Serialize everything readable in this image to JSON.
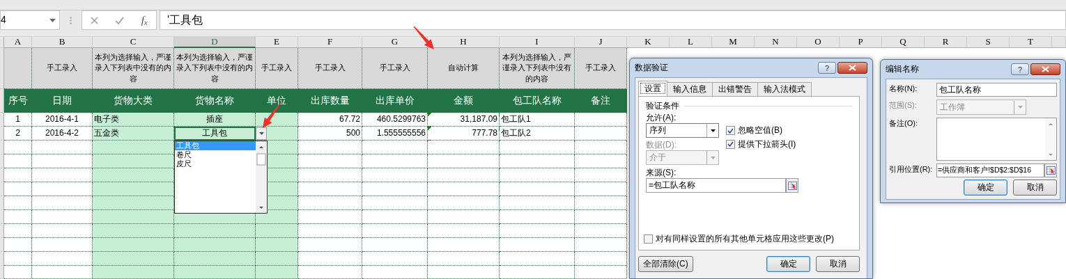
{
  "formula_bar": {
    "name_box": "4",
    "function_label": "f$_{x}$",
    "formula": "'工具包"
  },
  "sheet": {
    "columns": [
      {
        "letter": "A",
        "selected": false,
        "kind": "center",
        "highlighted": false,
        "title": "序号",
        "cells": [
          {
            "text": "1",
            "selected": false
          },
          {
            "text": "2",
            "selected": false
          }
        ]
      },
      {
        "letter": "B",
        "selected": false,
        "kind": "center",
        "highlighted": false,
        "note": "手工录入",
        "title": "日期",
        "cells": [
          {
            "text": "2016-4-1",
            "selected": false
          },
          {
            "text": "2016-4-2",
            "selected": false
          }
        ]
      },
      {
        "letter": "C",
        "selected": false,
        "kind": "text",
        "highlighted": true,
        "note": "本列为选择输入，严谨录入下列表中没有的内容",
        "title": "货物大类",
        "cells": [
          {
            "text": "电子类",
            "selected": false
          },
          {
            "text": "五金类",
            "selected": false
          }
        ]
      },
      {
        "letter": "D",
        "selected": true,
        "kind": "center",
        "highlighted": true,
        "note": "本列为选择输入，严谨录入下列表中没有的内容",
        "title": "货物名称",
        "cells": [
          {
            "text": "插座",
            "selected": false
          },
          {
            "text": "工具包",
            "selected": true
          }
        ]
      },
      {
        "letter": "E",
        "selected": false,
        "kind": "center",
        "highlighted": true,
        "note": "手工录入",
        "title": "单位"
      },
      {
        "letter": "F",
        "selected": false,
        "kind": "number",
        "highlighted": false,
        "note": "手工录入",
        "title": "出库数量",
        "cells": [
          {
            "text": "67.72",
            "selected": false
          },
          {
            "text": "500",
            "selected": false
          }
        ]
      },
      {
        "letter": "G",
        "selected": false,
        "kind": "number",
        "highlighted": false,
        "note": "手工录入",
        "title": "出库单价",
        "cells": [
          {
            "text": "460.5299763",
            "selected": false
          },
          {
            "text": "1.555555556",
            "selected": false
          }
        ]
      },
      {
        "letter": "H",
        "selected": false,
        "kind": "number",
        "highlighted": false,
        "note": "自动计算",
        "title": "金额",
        "cells": [
          {
            "text": "31,187.09",
            "selected": false,
            "flagged": true
          },
          {
            "text": "777.78",
            "selected": false,
            "flagged": true
          }
        ]
      },
      {
        "letter": "I",
        "selected": false,
        "kind": "text",
        "highlighted": false,
        "note": "本列为选择输入，严谨录入下列表中没有的内容",
        "title": "包工队名称",
        "cells": [
          {
            "text": "包工队1",
            "selected": false
          },
          {
            "text": "包工队2",
            "selected": false
          }
        ]
      },
      {
        "letter": "J",
        "selected": false,
        "kind": "center",
        "highlighted": false,
        "note": "手工录入",
        "title": "备注"
      },
      {
        "letter": "K",
        "selected": false
      },
      {
        "letter": "L",
        "selected": false
      },
      {
        "letter": "M",
        "selected": false
      },
      {
        "letter": "N",
        "selected": false
      },
      {
        "letter": "O",
        "selected": false
      },
      {
        "letter": "P",
        "selected": false
      },
      {
        "letter": "Q",
        "selected": false
      },
      {
        "letter": "R",
        "selected": false
      },
      {
        "letter": "S",
        "selected": false
      },
      {
        "letter": "T",
        "selected": false
      }
    ]
  },
  "dropdown_list": {
    "items": [
      {
        "text": "工具包",
        "selected": true
      },
      {
        "text": "卷尺",
        "selected": false
      },
      {
        "text": "皮尺",
        "selected": false
      }
    ]
  },
  "data_validation": {
    "title": "数据验证",
    "help": "?",
    "tabs": [
      {
        "label": "设置",
        "selected": true
      },
      {
        "label": "输入信息",
        "selected": false
      },
      {
        "label": "出错警告",
        "selected": false
      },
      {
        "label": "输入法模式",
        "selected": false
      }
    ],
    "section": "验证条件",
    "allow_label": "允许(A):",
    "allow_value": "序列",
    "checkboxes": [
      {
        "label": "忽略空值(B)",
        "checked": true
      },
      {
        "label": "提供下拉箭头(I)",
        "checked": true
      }
    ],
    "data_label": "数据(D):",
    "data_value": "介于",
    "data_disabled": true,
    "source_label": "来源(S):",
    "source_value": "=包工队名称",
    "apply_all": {
      "label": "对有同样设置的所有其他单元格应用这些更改(P)",
      "checked": false
    },
    "buttons": [
      {
        "label": "全部清除(C)",
        "default": false
      },
      {
        "label": "确定",
        "default": true
      },
      {
        "label": "取消",
        "default": false
      }
    ]
  },
  "edit_name": {
    "title": "编辑名称",
    "help": "?",
    "fields": [
      {
        "kind": "text",
        "label": "名称(N):",
        "value": "包工队名称",
        "disabled": false
      },
      {
        "kind": "select",
        "label": "范围(S):",
        "value": "工作簿",
        "disabled": true
      },
      {
        "kind": "memo",
        "label": "备注(O):",
        "disabled": false
      },
      {
        "kind": "reference",
        "label": "引用位置(R):",
        "value": "=供应商和客户!$D$2:$D$16",
        "disabled": false
      }
    ],
    "buttons": [
      {
        "label": "确定",
        "default": true
      },
      {
        "label": "取消",
        "default": false
      }
    ]
  }
}
